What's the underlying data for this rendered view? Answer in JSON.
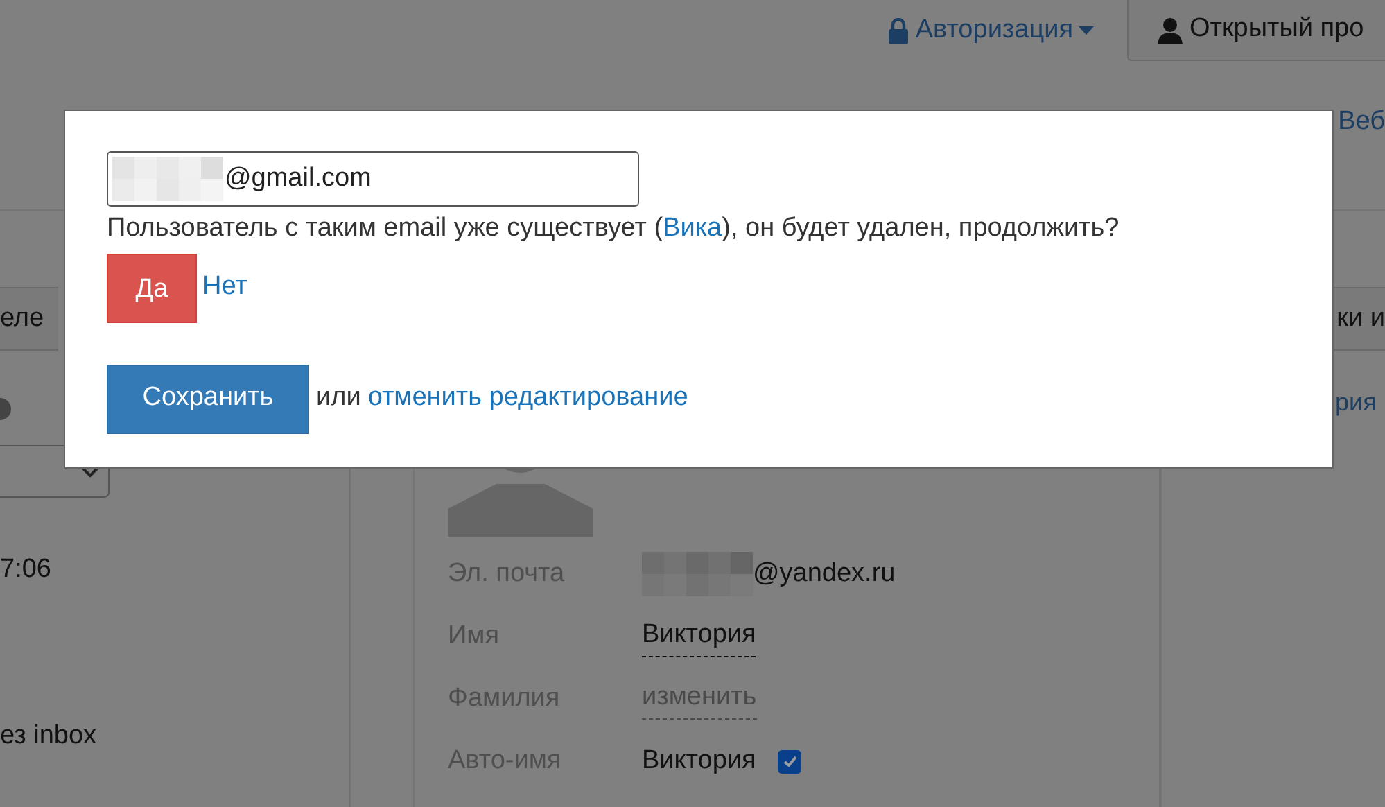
{
  "header": {
    "auth_menu": "Авторизация",
    "profile_button": "Открытый про"
  },
  "nav": {
    "right_link": "Веб"
  },
  "tabs": [
    {
      "label": "еле",
      "selected": false
    },
    {
      "label": "ки и",
      "selected": false
    }
  ],
  "left_column": {
    "time": "7:06",
    "note": "ез inbox"
  },
  "profile": {
    "fields": [
      {
        "label": "Эл. почта",
        "value": "@yandex.ru",
        "kind": "email"
      },
      {
        "label": "Имя",
        "value": "Виктория",
        "kind": "editable"
      },
      {
        "label": "Фамилия",
        "value": "изменить",
        "kind": "placeholder"
      },
      {
        "label": "Авто-имя",
        "value": "Виктория",
        "kind": "checkbox",
        "checked": true
      }
    ]
  },
  "right_column": {
    "link": "рия"
  },
  "dialog": {
    "email_value": "@gmail.com",
    "message": {
      "before": "Пользователь с таким email уже существует (",
      "link": "Вика",
      "after": "), он будет удален, продолжить?"
    },
    "confirm_button": "Да",
    "decline_link": "Нет",
    "save_button": "Сохранить",
    "or_text": "или",
    "cancel_link": "отменить редактирование"
  }
}
